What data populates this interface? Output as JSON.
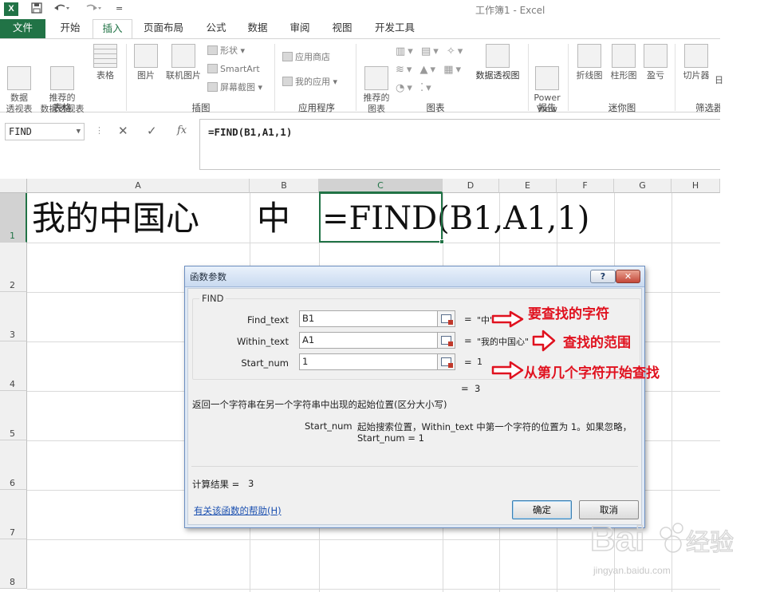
{
  "window": {
    "title": "工作簿1 - Excel",
    "logo": "X"
  },
  "quick_access": {
    "save_icon": "save-icon",
    "undo_icon": "undo-icon",
    "redo_icon": "redo-icon",
    "customize": "="
  },
  "tabs": [
    "文件",
    "开始",
    "插入",
    "页面布局",
    "公式",
    "数据",
    "审阅",
    "视图",
    "开发工具"
  ],
  "active_tab": "插入",
  "ribbon": {
    "tables": {
      "pivot": "数据\n透视表",
      "rec_pivot": "推荐的\n数据透视表",
      "table": "表格",
      "group": "表格"
    },
    "illustrations": {
      "picture": "图片",
      "online_picture": "联机图片",
      "shapes": "形状",
      "smartart": "SmartArt",
      "screenshot": "屏幕截图",
      "group": "插图"
    },
    "apps": {
      "store": "应用商店",
      "my_apps": "我的应用",
      "group": "应用程序"
    },
    "charts": {
      "rec_charts": "推荐的\n图表",
      "pivot_chart": "数据透视图",
      "group": "图表"
    },
    "reports": {
      "power_view": "Power\nView",
      "group": "报告"
    },
    "sparklines": {
      "line": "折线图",
      "column": "柱形图",
      "winloss": "盈亏",
      "group": "迷你图"
    },
    "filters": {
      "slicer": "切片器",
      "timeline": "日",
      "group": "筛选器"
    }
  },
  "formula_bar": {
    "name_box": "FIND",
    "cancel": "✕",
    "enter": "✓",
    "fx": "fx",
    "formula": "=FIND(B1,A1,1)"
  },
  "sheet": {
    "columns": [
      "A",
      "B",
      "C",
      "D",
      "E",
      "F",
      "G",
      "H"
    ],
    "rows": [
      "1",
      "2",
      "3",
      "4",
      "5",
      "6",
      "7",
      "8"
    ],
    "active_column": "C",
    "active_row": "1",
    "cells": {
      "A1": "我的中国心",
      "B1": "中",
      "C1": "=FIND(B1,A1,1)"
    }
  },
  "dialog": {
    "title": "函数参数",
    "help_btn": "?",
    "close_btn": "✕",
    "function_name": "FIND",
    "args": [
      {
        "label": "Find_text",
        "value": "B1",
        "eq": "=",
        "result": "\"中\""
      },
      {
        "label": "Within_text",
        "value": "A1",
        "eq": "=",
        "result": "\"我的中国心\""
      },
      {
        "label": "Start_num",
        "value": "1",
        "eq": "=",
        "result": "1"
      }
    ],
    "overall_eq": "=",
    "overall_result": "3",
    "description": "返回一个字符串在另一个字符串中出现的起始位置(区分大小写)",
    "param_name": "Start_num",
    "param_desc_line1": "起始搜索位置，Within_text 中第一个字符的位置为 1。如果忽略，",
    "param_desc_line2": "Start_num = 1",
    "calc_label": "计算结果 =",
    "calc_value": "3",
    "help_link": "有关该函数的帮助(H)",
    "ok": "确定",
    "cancel": "取消"
  },
  "annotations": [
    "要查找的字符",
    "查找的范围",
    "从第几个字符开始查找"
  ],
  "annotation_color": "#e0121f",
  "watermark": {
    "text": "jingyan.baidu.com"
  }
}
